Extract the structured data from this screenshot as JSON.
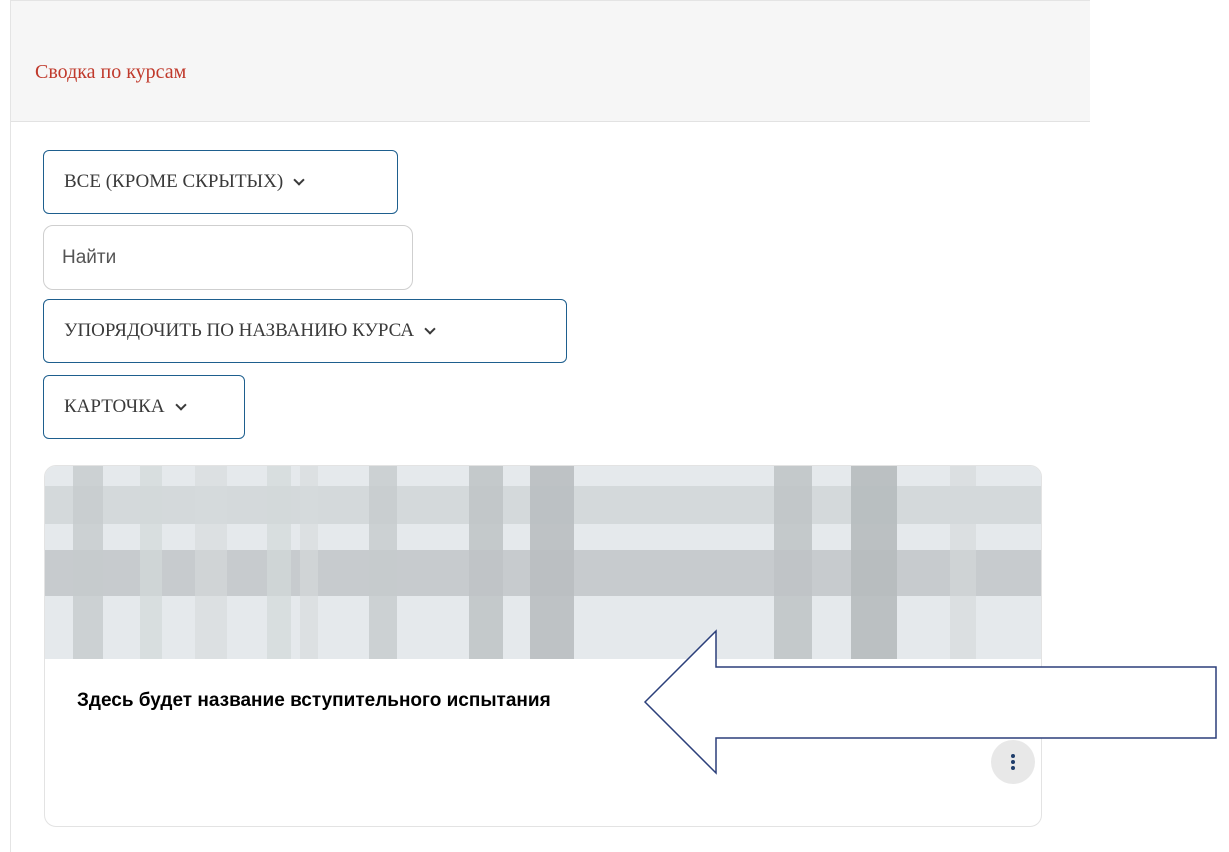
{
  "header": {
    "title": "Сводка по курсам"
  },
  "filters": {
    "grouping_label": "ВСЕ (КРОМЕ СКРЫТЫХ)",
    "search_placeholder": "Найти",
    "sort_label": "УПОРЯДОЧИТЬ ПО НАЗВАНИЮ КУРСА",
    "view_label": "КАРТОЧКА"
  },
  "course_card": {
    "title": "Здесь будет название вступительного испытания",
    "menu_icon": "kebab-menu-icon"
  },
  "annotation": {
    "icon": "left-arrow-annotation"
  },
  "colors": {
    "title_red": "#c0392b",
    "dropdown_border": "#1e5f8e",
    "arrow_stroke": "#2b3f7a"
  }
}
